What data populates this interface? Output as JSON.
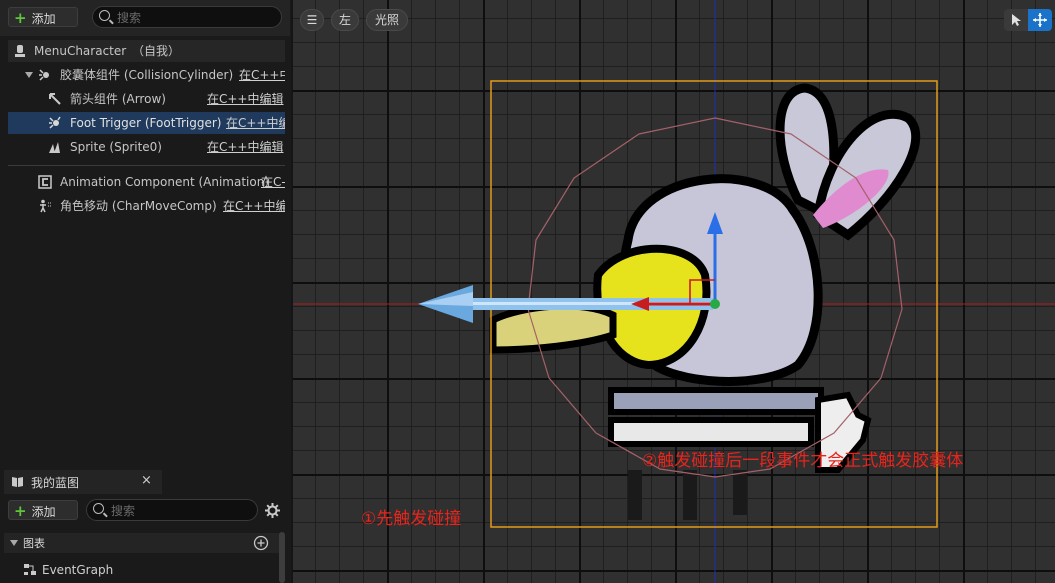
{
  "components_panel": {
    "add_label": "添加",
    "search_placeholder": "搜索",
    "root": {
      "name": "MenuCharacter",
      "suffix": "（自我）"
    },
    "items": [
      {
        "label": "胶囊体组件 (CollisionCylinder)",
        "edit": "在C++中",
        "icon": "capsule-component-icon"
      },
      {
        "label": "箭头组件 (Arrow)",
        "edit": "在C++中编辑",
        "icon": "arrow-component-icon"
      },
      {
        "label": "Foot Trigger (FootTrigger)",
        "edit": "在C++中编",
        "icon": "trigger-component-icon"
      },
      {
        "label": "Sprite (Sprite0)",
        "edit": "在C++中编辑",
        "icon": "sprite-component-icon"
      },
      {
        "label": "Animation Component (Animation)",
        "edit": "在C-",
        "icon": "animation-component-icon"
      },
      {
        "label": "角色移动 (CharMoveComp)",
        "edit": "在C++中编",
        "icon": "character-movement-icon"
      }
    ]
  },
  "blueprint_panel": {
    "tab_label": "我的蓝图",
    "close": "×",
    "add_label": "添加",
    "search_placeholder": "搜索",
    "section_label": "图表",
    "graph_item": "EventGraph"
  },
  "viewport": {
    "menu_label": "☰",
    "view_label": "左",
    "lighting_label": "光照",
    "annotation_1": "①先触发碰撞",
    "annotation_2": "②触发碰撞后一段事件才会正式触发胶囊体",
    "accent_color": "#1a73c9",
    "bounds_color": "#e39b19",
    "sphere_color": "#a4616a"
  }
}
